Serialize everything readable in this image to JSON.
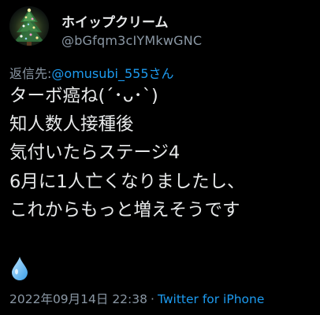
{
  "user": {
    "display_name": "ホイップクリーム",
    "handle": "@bGfqm3cIYMkwGNC",
    "avatar_icon": "christmas-tree-avatar"
  },
  "reply": {
    "prefix": "返信先:",
    "mention": "@omusubi_555さん"
  },
  "body_lines": [
    "ターボ癌ね(´･ᴗ･`)",
    "知人数人接種後",
    "気付いたらステージ4",
    "6月に1人亡くなりましたし、",
    "これからもっと増えそうです"
  ],
  "emoji_icon": "droplet-icon",
  "meta": {
    "timestamp": "2022年09月14日 22:38",
    "separator": "·",
    "source": "Twitter for iPhone"
  },
  "colors": {
    "background": "#000000",
    "text": "#e7e9ea",
    "secondary": "#8b98a5",
    "link": "#1d9bf0"
  }
}
